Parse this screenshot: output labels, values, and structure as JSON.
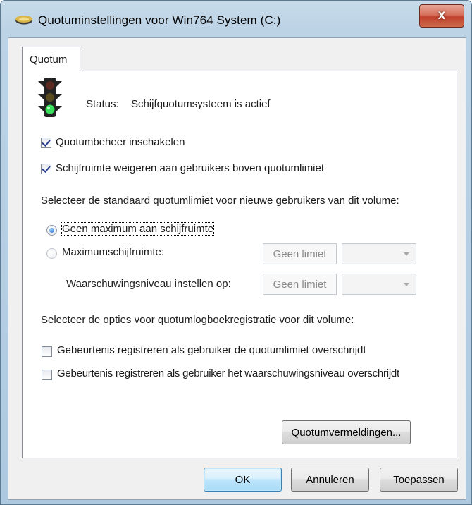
{
  "window": {
    "title": "Quotuminstellingen voor Win764 System  (C:)",
    "close_glyph": "x"
  },
  "tabs": [
    {
      "label": "Quotum"
    }
  ],
  "status": {
    "label": "Status:",
    "value": "Schijfquotumsysteem is actief",
    "icon": "traffic-light-icon"
  },
  "options": {
    "enable_quota": {
      "label": "Quotumbeheer inschakelen",
      "checked": true
    },
    "deny_space": {
      "label": "Schijfruimte weigeren aan gebruikers boven quotumlimiet",
      "checked": true
    }
  },
  "default_limit": {
    "heading": "Selecteer de standaard quotumlimiet voor nieuwe gebruikers van dit volume:",
    "no_limit": {
      "label": "Geen maximum aan schijfruimte",
      "selected": true
    },
    "limit_to": {
      "label": "Maximumschijfruimte:",
      "selected": false,
      "value": "Geen limiet"
    },
    "warning": {
      "label": "Waarschuwingsniveau instellen op:",
      "value": "Geen limiet"
    }
  },
  "logging": {
    "heading": "Selecteer de opties voor quotumlogboekregistratie voor dit volume:",
    "log_exceed_limit": {
      "label": "Gebeurtenis registreren als gebruiker de quotumlimiet overschrijdt",
      "checked": false
    },
    "log_exceed_warning": {
      "label": "Gebeurtenis registreren als gebruiker het waarschuwingsniveau overschrijdt",
      "checked": false
    }
  },
  "buttons": {
    "entries": "Quotumvermeldingen...",
    "ok": "OK",
    "cancel": "Annuleren",
    "apply": "Toepassen"
  },
  "colors": {
    "accent": "#3c7fb1",
    "close": "#c0402b"
  }
}
